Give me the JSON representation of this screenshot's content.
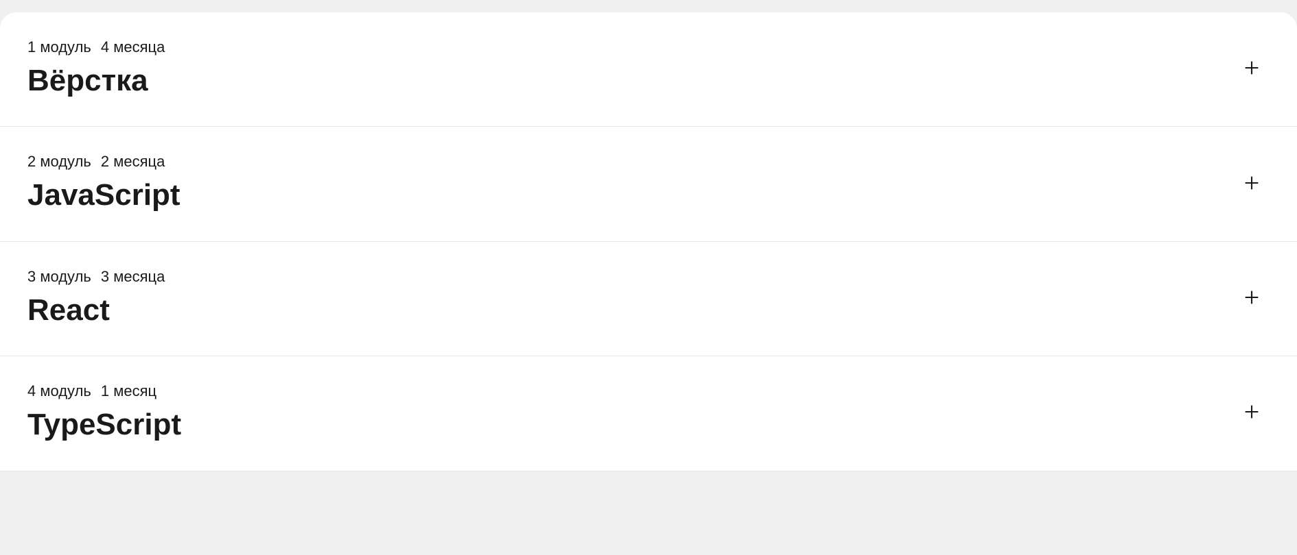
{
  "modules": [
    {
      "module_label": "1 модуль",
      "duration": "4 месяца",
      "title": "Вёрстка"
    },
    {
      "module_label": "2 модуль",
      "duration": "2 месяца",
      "title": "JavaScript"
    },
    {
      "module_label": "3 модуль",
      "duration": "3 месяца",
      "title": "React"
    },
    {
      "module_label": "4 модуль",
      "duration": "1 месяц",
      "title": "TypeScript"
    }
  ]
}
